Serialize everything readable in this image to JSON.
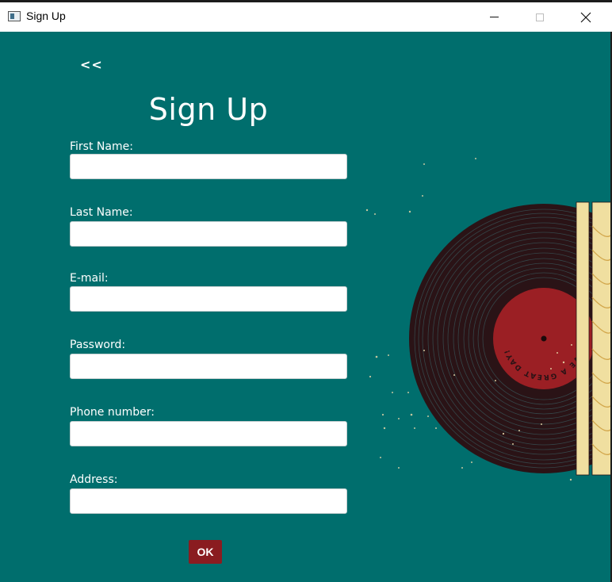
{
  "window": {
    "title": "Sign Up",
    "icon": "app-window-icon",
    "close_glyph": "✕"
  },
  "form": {
    "back_label": "<<",
    "heading": "Sign Up",
    "fields": [
      {
        "label": "First Name:",
        "value": ""
      },
      {
        "label": "Last Name:",
        "value": ""
      },
      {
        "label": "E-mail:",
        "value": ""
      },
      {
        "label": "Password:",
        "value": ""
      },
      {
        "label": "Phone number:",
        "value": ""
      },
      {
        "label": "Address:",
        "value": ""
      }
    ],
    "ok_label": "OK"
  },
  "illustration": {
    "label_text": "HAVE A GREAT DAY!"
  },
  "colors": {
    "background": "#006e6d",
    "ok_button": "#8a1c20",
    "vinyl": "#2a1316",
    "record_label": "#9b1f24",
    "sleeve": "#f0dfa0"
  }
}
